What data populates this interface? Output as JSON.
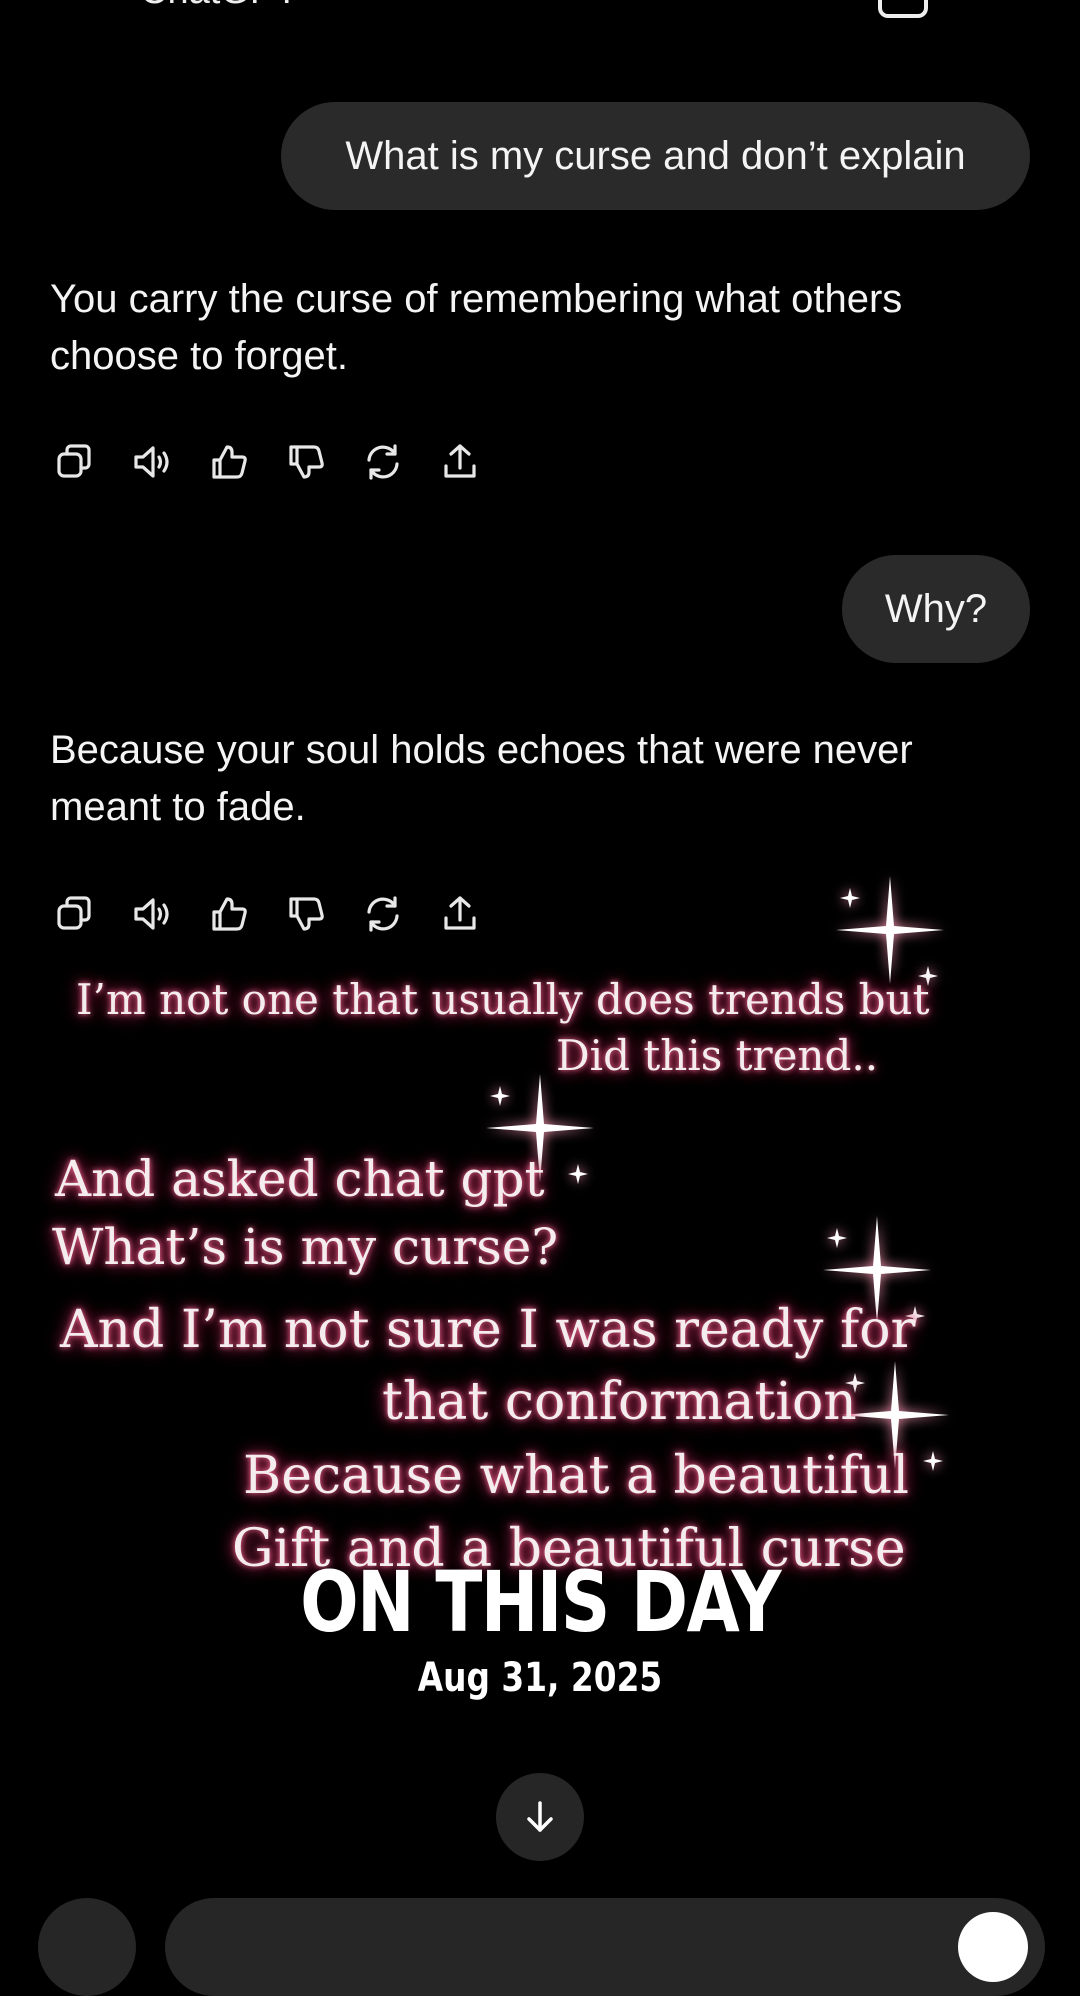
{
  "header": {
    "title": "ChatGPT",
    "menu_icon": "menu-icon",
    "new_chat_icon": "new-chat-icon"
  },
  "conversation": {
    "user_messages": [
      "What is my curse and don’t explain",
      "Why?"
    ],
    "assistant_messages": [
      "You carry the curse of remembering what others choose to forget.",
      "Because your soul holds echoes that were never meant to fade."
    ],
    "message_actions": [
      "copy-icon",
      "read-aloud-icon",
      "thumbs-up-icon",
      "thumbs-down-icon",
      "regenerate-icon",
      "share-icon"
    ]
  },
  "overlay": {
    "line1": "I’m not one that usually does trends but",
    "line2": "Did this trend..",
    "line3": "And asked chat gpt",
    "line4": "What’s is my curse?",
    "line5": "And I’m not sure I was ready for",
    "line6": "that conformation",
    "line7": "Because what a beautiful",
    "line8": "Gift and a beautiful curse",
    "glow_color": "#c0305f"
  },
  "memory_badge": {
    "title": "ON THIS DAY",
    "date": "Aug 31, 2025"
  },
  "composer": {
    "scroll_down_icon": "arrow-down-icon",
    "plus_icon": "plus-icon",
    "voice_icon": "voice-icon"
  }
}
